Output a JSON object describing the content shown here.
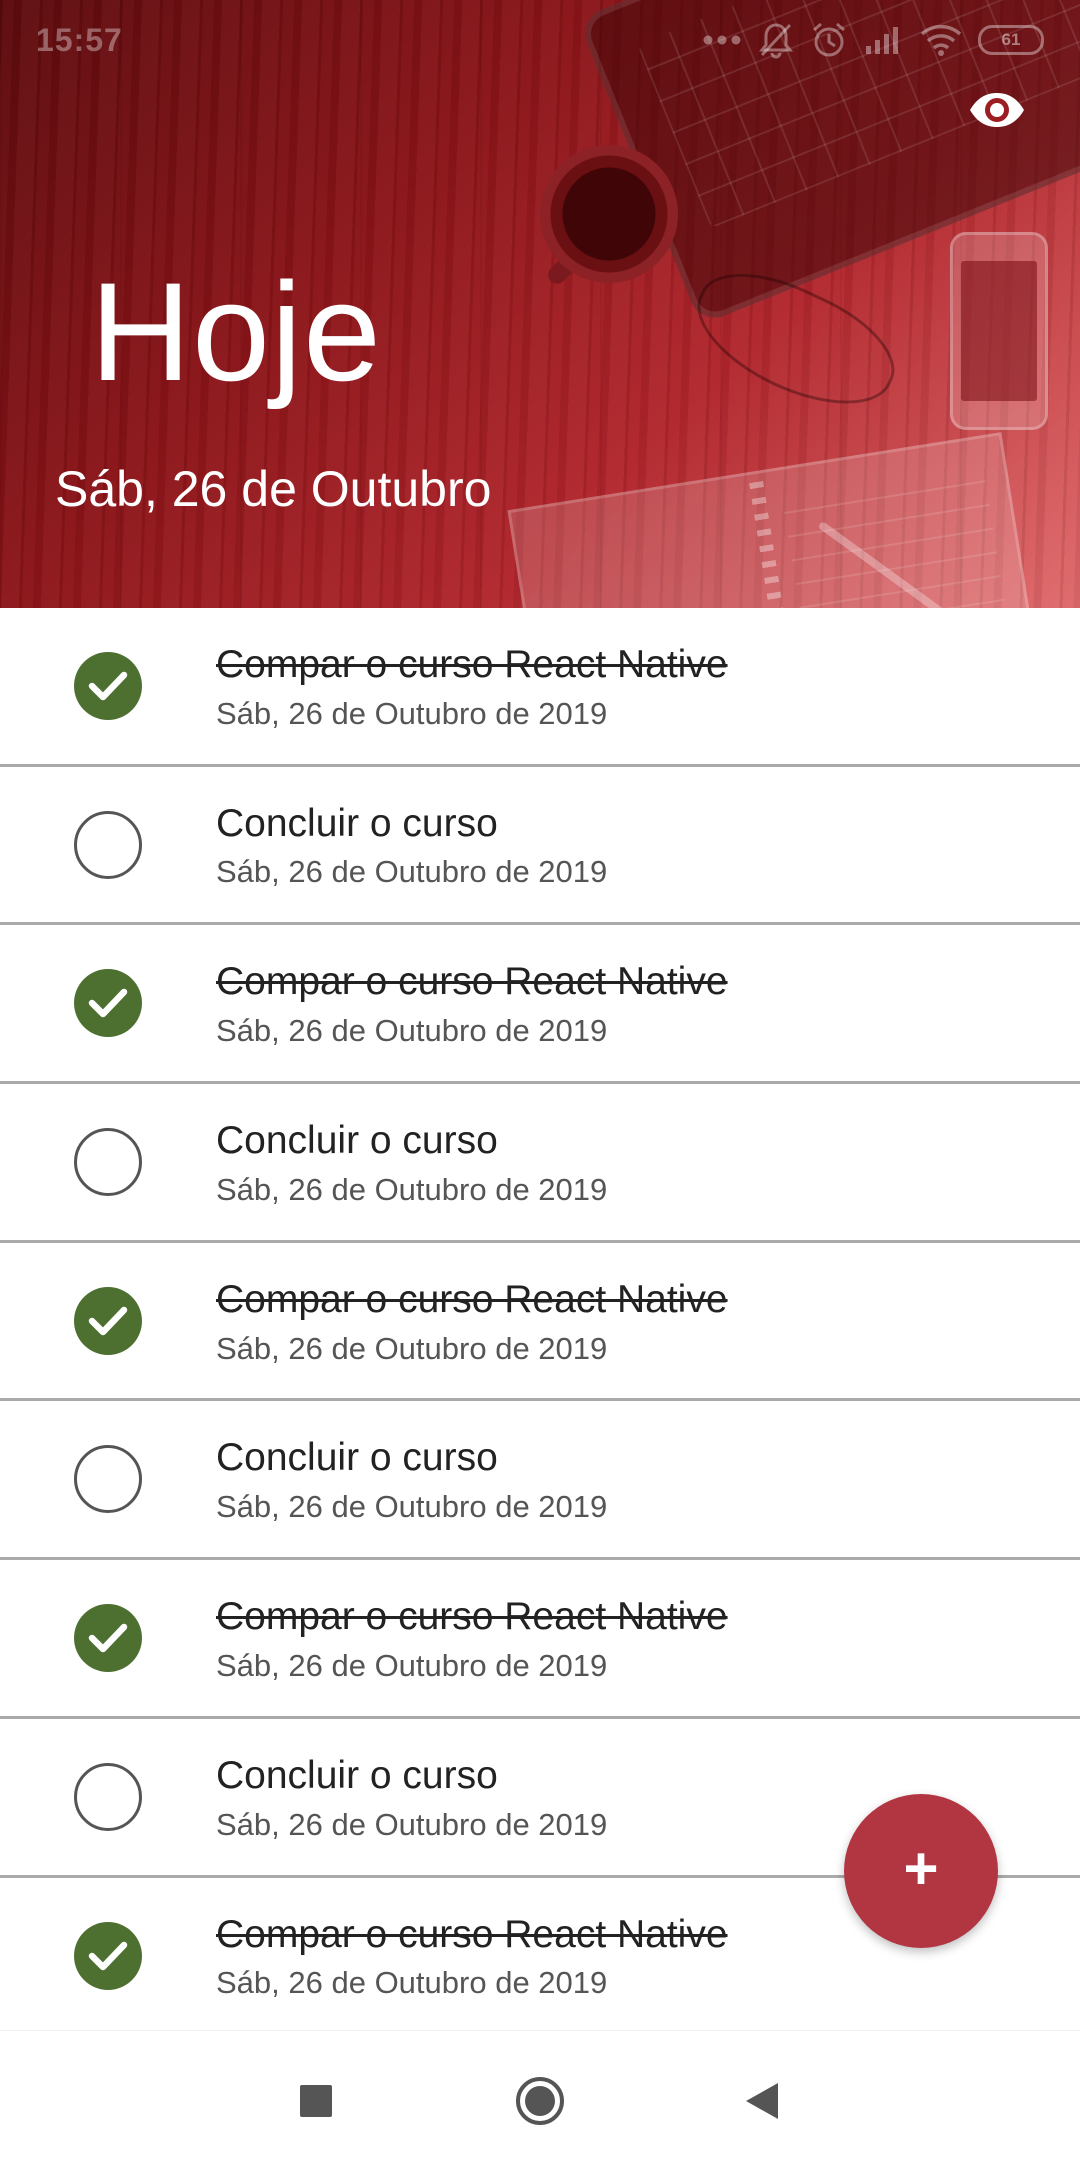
{
  "status_bar": {
    "time": "15:57",
    "battery": "61",
    "icons": [
      "more-dots-icon",
      "bell-off-icon",
      "alarm-icon",
      "signal-icon",
      "wifi-icon",
      "battery-icon"
    ]
  },
  "header": {
    "title": "Hoje",
    "date": "Sáb, 26 de Outubro",
    "toggle_icon": "eye-icon",
    "accent_color": "#b1262c"
  },
  "tasks": [
    {
      "title": "Compar o curso React Native",
      "date": "Sáb, 26 de Outubro de 2019",
      "done": true
    },
    {
      "title": "Concluir o curso",
      "date": "Sáb, 26 de Outubro de 2019",
      "done": false
    },
    {
      "title": "Compar o curso React Native",
      "date": "Sáb, 26 de Outubro de 2019",
      "done": true
    },
    {
      "title": "Concluir o curso",
      "date": "Sáb, 26 de Outubro de 2019",
      "done": false
    },
    {
      "title": "Compar o curso React Native",
      "date": "Sáb, 26 de Outubro de 2019",
      "done": true
    },
    {
      "title": "Concluir o curso",
      "date": "Sáb, 26 de Outubro de 2019",
      "done": false
    },
    {
      "title": "Compar o curso React Native",
      "date": "Sáb, 26 de Outubro de 2019",
      "done": true
    },
    {
      "title": "Concluir o curso",
      "date": "Sáb, 26 de Outubro de 2019",
      "done": false
    },
    {
      "title": "Compar o curso React Native",
      "date": "Sáb, 26 de Outubro de 2019",
      "done": true
    }
  ],
  "colors": {
    "done_check": "#4d7031",
    "fab": "#b13642",
    "divider": "#aaaaaa"
  },
  "fab": {
    "label": "+",
    "icon": "plus-icon"
  },
  "nav": {
    "icons": [
      "recent-apps-square-icon",
      "home-circle-icon",
      "back-triangle-icon"
    ]
  }
}
